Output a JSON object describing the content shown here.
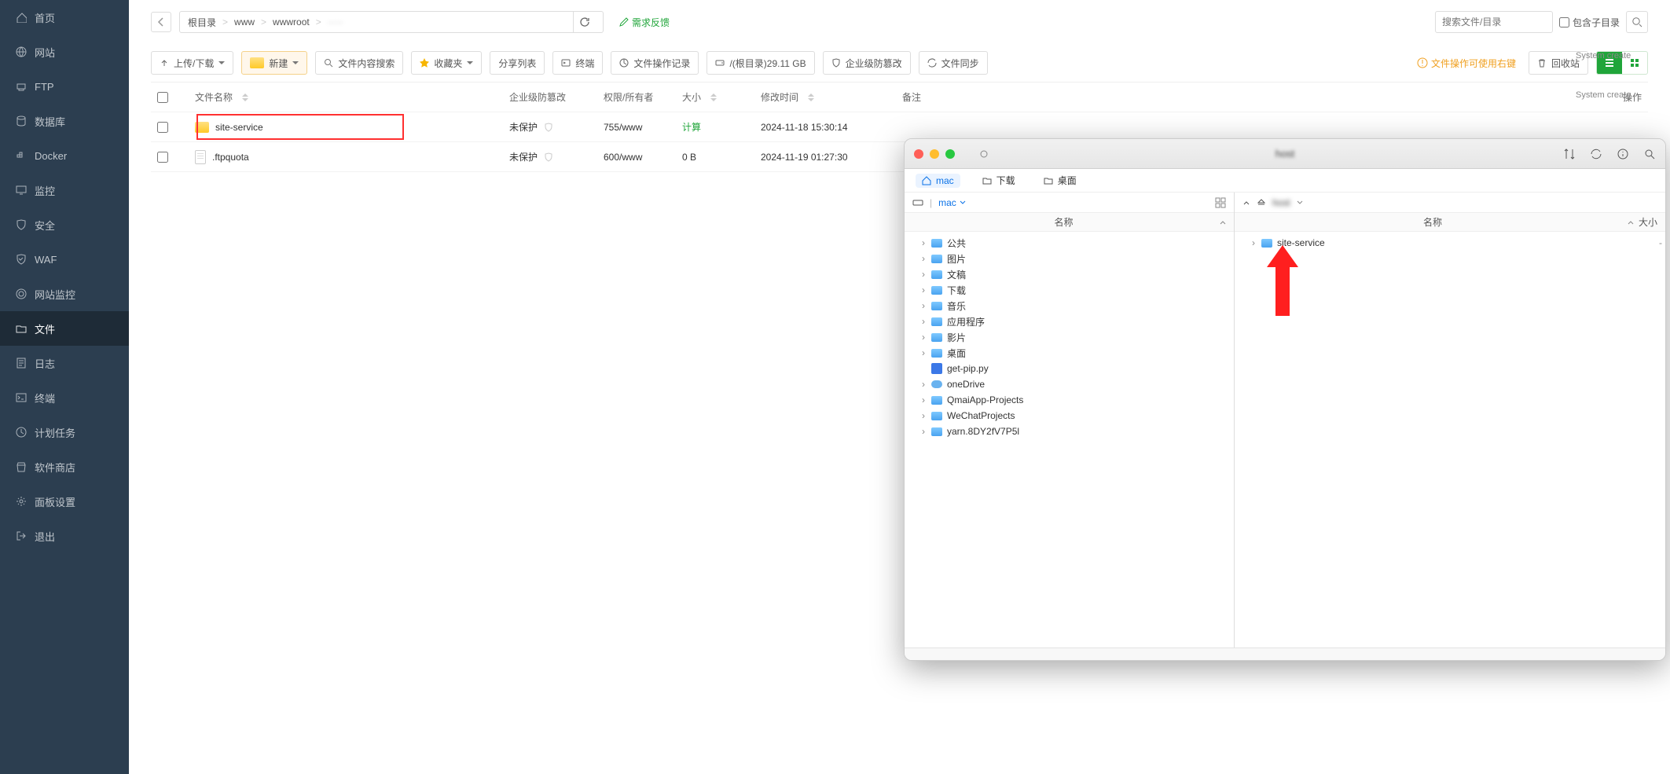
{
  "sidebar": {
    "items": [
      {
        "label": "首页",
        "icon": "home"
      },
      {
        "label": "网站",
        "icon": "globe"
      },
      {
        "label": "FTP",
        "icon": "ftp"
      },
      {
        "label": "数据库",
        "icon": "db"
      },
      {
        "label": "Docker",
        "icon": "docker"
      },
      {
        "label": "监控",
        "icon": "monitor"
      },
      {
        "label": "安全",
        "icon": "shield"
      },
      {
        "label": "WAF",
        "icon": "waf"
      },
      {
        "label": "网站监控",
        "icon": "radar"
      },
      {
        "label": "文件",
        "icon": "folder",
        "active": true
      },
      {
        "label": "日志",
        "icon": "log"
      },
      {
        "label": "终端",
        "icon": "terminal"
      },
      {
        "label": "计划任务",
        "icon": "clock"
      },
      {
        "label": "软件商店",
        "icon": "store"
      },
      {
        "label": "面板设置",
        "icon": "gear"
      },
      {
        "label": "退出",
        "icon": "logout"
      }
    ]
  },
  "breadcrumb": {
    "segments": [
      "根目录",
      "www",
      "wwwroot",
      "·····"
    ]
  },
  "feedback": "需求反馈",
  "search": {
    "placeholder": "搜索文件/目录",
    "subdir_label": "包含子目录"
  },
  "toolbar": {
    "upload": "上传/下载",
    "new": "新建",
    "content_search": "文件内容搜索",
    "fav": "收藏夹",
    "share": "分享列表",
    "terminal": "终端",
    "ops_log": "文件操作记录",
    "disk": "/(根目录)29.11 GB",
    "tamper": "企业级防篡改",
    "sync": "文件同步",
    "right_click_tip": "文件操作可使用右键",
    "recycle": "回收站"
  },
  "table": {
    "cols": {
      "name": "文件名称",
      "tamper": "企业级防篡改",
      "perm": "权限/所有者",
      "size": "大小",
      "mtime": "修改时间",
      "note": "备注",
      "op": "操作"
    },
    "rows": [
      {
        "type": "folder",
        "name": "site-service",
        "tamper": "未保护",
        "perm": "755/www",
        "size": "计算",
        "size_calc": true,
        "mtime": "2024-11-18 15:30:14",
        "highlight": true
      },
      {
        "type": "file",
        "name": ".ftpquota",
        "tamper": "未保护",
        "perm": "600/www",
        "size": "0 B",
        "size_calc": false,
        "mtime": "2024-11-19 01:27:30"
      }
    ]
  },
  "rightStrip": [
    "System create",
    "System create"
  ],
  "ftp": {
    "title": "host",
    "toptabs": {
      "mac": "mac",
      "download": "下载",
      "desktop": "桌面"
    },
    "leftPath": "mac",
    "rightHost": "host",
    "headers": {
      "name": "名称",
      "size": "大小"
    },
    "leftTree": [
      {
        "name": "公共",
        "kind": "folder",
        "expand": true
      },
      {
        "name": "图片",
        "kind": "folder",
        "expand": true
      },
      {
        "name": "文稿",
        "kind": "folder",
        "expand": true
      },
      {
        "name": "下载",
        "kind": "folder",
        "expand": true
      },
      {
        "name": "音乐",
        "kind": "folder",
        "expand": true
      },
      {
        "name": "应用程序",
        "kind": "folder",
        "expand": true
      },
      {
        "name": "影片",
        "kind": "folder",
        "expand": true
      },
      {
        "name": "桌面",
        "kind": "folder",
        "expand": true
      },
      {
        "name": "get-pip.py",
        "kind": "py",
        "expand": false
      },
      {
        "name": "oneDrive",
        "kind": "cloud",
        "expand": true
      },
      {
        "name": "QmaiApp-Projects",
        "kind": "folder",
        "expand": true
      },
      {
        "name": "WeChatProjects",
        "kind": "folder",
        "expand": true
      },
      {
        "name": "yarn.8DY2fV7P5l",
        "kind": "folder",
        "expand": true
      }
    ],
    "rightTree": [
      {
        "name": "site-service",
        "kind": "folder",
        "size": "-",
        "expand": true
      }
    ]
  }
}
